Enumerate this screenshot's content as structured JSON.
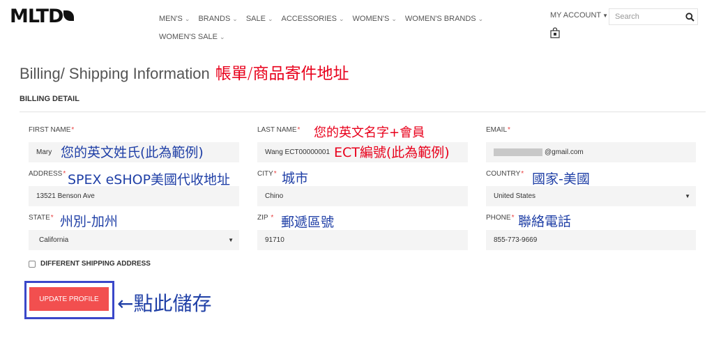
{
  "header": {
    "logo": "MLTD",
    "nav": [
      {
        "label": "MEN'S"
      },
      {
        "label": "BRANDS"
      },
      {
        "label": "SALE"
      },
      {
        "label": "ACCESSORIES"
      },
      {
        "label": "WOMEN'S"
      },
      {
        "label": "WOMEN'S BRANDS"
      },
      {
        "label": "WOMEN'S SALE"
      }
    ],
    "account_label": "MY ACCOUNT",
    "search_placeholder": "Search"
  },
  "page": {
    "title": "Billing/ Shipping Information",
    "title_annotation": "帳單/商品寄件地址",
    "section_title": "BILLING DETAIL"
  },
  "form": {
    "first_name": {
      "label": "FIRST NAME",
      "value": "Mary",
      "annotation": "您的英文姓氏(此為範例)"
    },
    "last_name": {
      "label": "LAST NAME",
      "value": "Wang ECT00000001",
      "annotation_top": "您的英文名字+會員",
      "annotation": "ECT編號(此為範例)"
    },
    "email": {
      "label": "EMAIL",
      "value": "@gmail.com"
    },
    "address": {
      "label": "ADDRESS",
      "value": "13521 Benson Ave",
      "annotation": "SPEX eSHOP美國代收地址"
    },
    "city": {
      "label": "CITY",
      "value": "Chino",
      "annotation": "城市"
    },
    "country": {
      "label": "COUNTRY",
      "value": "United States",
      "annotation": "國家-美國"
    },
    "state": {
      "label": "STATE",
      "value": "California",
      "annotation": "州別-加州"
    },
    "zip": {
      "label": "ZIP",
      "value": "91710",
      "annotation": "郵遞區號"
    },
    "phone": {
      "label": "PHONE",
      "value": "855-773-9669",
      "annotation": "聯絡電話"
    },
    "different_shipping": "DIFFERENT SHIPPING ADDRESS",
    "submit_label": "UPDATE PROFILE",
    "submit_annotation": "←點此儲存"
  },
  "colors": {
    "accent": "#f24f4f",
    "annotation_blue": "#1f3fa6",
    "annotation_red": "#e8001b"
  },
  "icons": {
    "search": "search-icon",
    "cart": "shopping-bag-icon",
    "chevron": "chevron-down-icon"
  }
}
